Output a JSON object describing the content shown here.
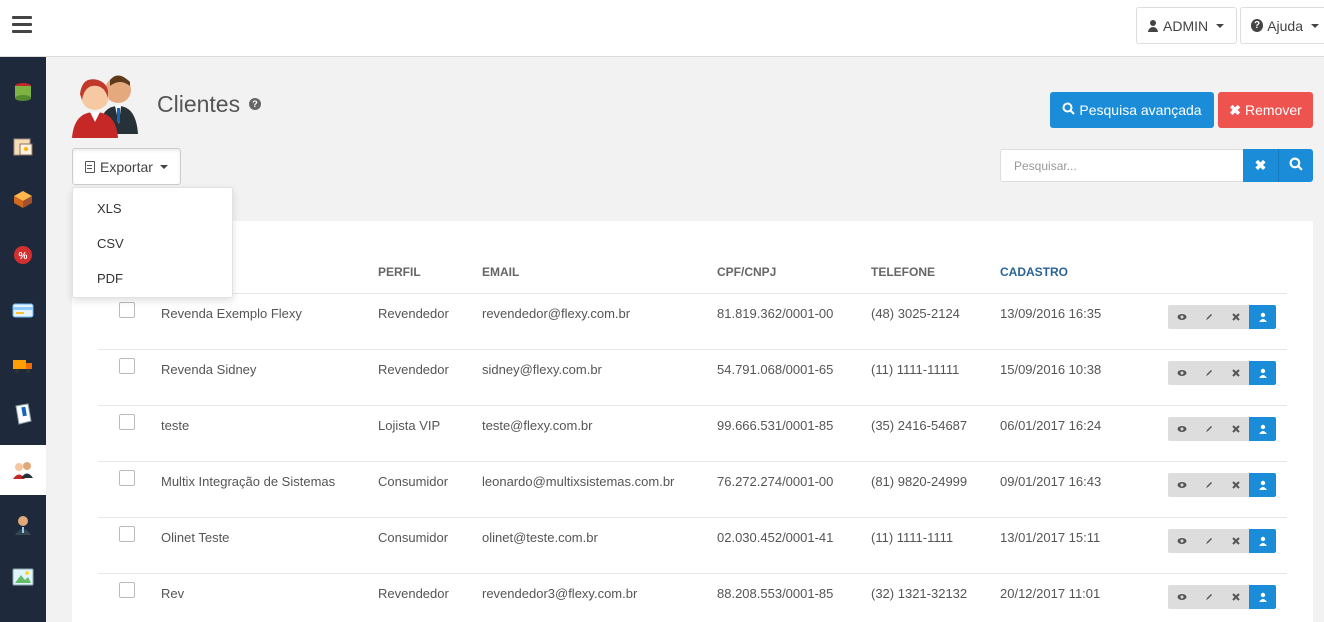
{
  "header": {
    "admin_label": "ADMIN",
    "help_label": "Ajuda"
  },
  "page": {
    "title": "Clientes"
  },
  "actions": {
    "advanced_search": "Pesquisa avançada",
    "remove": "Remover",
    "export": "Exportar",
    "export_options": [
      "XLS",
      "CSV",
      "PDF"
    ]
  },
  "search": {
    "placeholder": "Pesquisar..."
  },
  "table": {
    "columns": [
      "PERFIL",
      "EMAIL",
      "CPF/CNPJ",
      "TELEFONE",
      "CADASTRO"
    ],
    "rows": [
      {
        "name": "Revenda Exemplo Flexy",
        "perfil": "Revendedor",
        "email": "revendedor@flexy.com.br",
        "doc": "81.819.362/0001-00",
        "phone": "(48) 3025-2124",
        "date": "13/09/2016 16:35"
      },
      {
        "name": "Revenda Sidney",
        "perfil": "Revendedor",
        "email": "sidney@flexy.com.br",
        "doc": "54.791.068/0001-65",
        "phone": "(11) 1111-11111",
        "date": "15/09/2016 10:38"
      },
      {
        "name": "teste",
        "perfil": "Lojista VIP",
        "email": "teste@flexy.com.br",
        "doc": "99.666.531/0001-85",
        "phone": "(35) 2416-54687",
        "date": "06/01/2017 16:24"
      },
      {
        "name": "Multix Integração de Sistemas",
        "perfil": "Consumidor",
        "email": "leonardo@multixsistemas.com.br",
        "doc": "76.272.274/0001-00",
        "phone": "(81) 9820-24999",
        "date": "09/01/2017 16:43"
      },
      {
        "name": "Olinet Teste",
        "perfil": "Consumidor",
        "email": "olinet@teste.com.br",
        "doc": "02.030.452/0001-41",
        "phone": "(11) 1111-1111",
        "date": "13/01/2017 15:11"
      },
      {
        "name": "Rev",
        "perfil": "Revendedor",
        "email": "revendedor3@flexy.com.br",
        "doc": "88.208.553/0001-85",
        "phone": "(32) 1321-32132",
        "date": "20/12/2017 11:01"
      }
    ]
  },
  "sidebar": {
    "items": [
      {
        "icon": "database-icon",
        "color": "#7cb342"
      },
      {
        "icon": "catalog-icon",
        "color": "#f5deb3"
      },
      {
        "icon": "box-icon",
        "color": "#d2691e"
      },
      {
        "icon": "discount-icon",
        "color": "#d32f2f"
      },
      {
        "icon": "payment-card-icon",
        "color": "#90caf9"
      },
      {
        "icon": "truck-icon",
        "color": "#ffa000"
      },
      {
        "icon": "document-icon",
        "color": "#e3f2fd"
      },
      {
        "icon": "clients-icon",
        "color": "#c62828"
      },
      {
        "icon": "seller-icon",
        "color": "#5d4037"
      },
      {
        "icon": "image-gallery-icon",
        "color": "#4fc3f7"
      }
    ]
  },
  "colors": {
    "primary": "#1a8cd8",
    "danger": "#ef5350",
    "sidebar": "#1e2a3b",
    "sorted_header": "#2a6496"
  }
}
